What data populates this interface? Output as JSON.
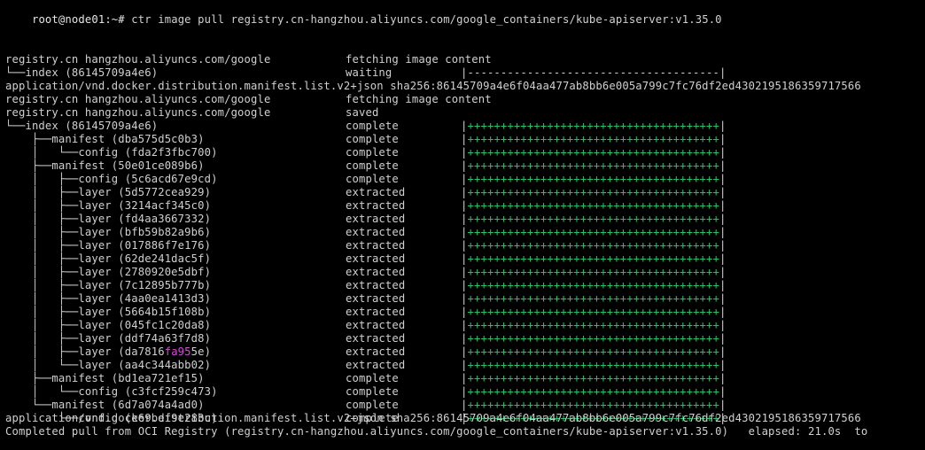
{
  "terminal": {
    "prompt": "root@node01:~#",
    "command": "ctr image pull registry.cn-hangzhou.aliyuncs.com/google_containers/kube-apiserver:v1.35.0",
    "first_block": [
      {
        "name": "registry.cn hangzhou.aliyuncs.com/google",
        "status": "fetching image content"
      },
      {
        "name": "└──index (86145709a4e6)",
        "status": "waiting",
        "bar": "|--------------------------------------|"
      }
    ],
    "manifest_line": "application/vnd.docker.distribution.manifest.list.v2+json sha256:86145709a4e6f04aa477ab8bb6e005a799c7fc76df2ed4302195186359717566",
    "second_block": [
      {
        "name": "registry.cn hangzhou.aliyuncs.com/google",
        "status": "fetching image content"
      },
      {
        "name": "registry.cn hangzhou.aliyuncs.com/google",
        "status": "saved"
      },
      {
        "name": "└──index (86145709a4e6)",
        "status": "complete"
      },
      {
        "name": "    ├──manifest (dba575d5c0b3)",
        "status": "complete"
      },
      {
        "name": "    │   └──config (fda2f3fbc700)",
        "status": "complete"
      },
      {
        "name": "    ├──manifest (50e01ce089b6)",
        "status": "complete"
      },
      {
        "name": "    │   ├──config (5c6acd67e9cd)",
        "status": "complete"
      },
      {
        "name": "    │   ├──layer (5d5772cea929)",
        "status": "extracted"
      },
      {
        "name": "    │   ├──layer (3214acf345c0)",
        "status": "extracted"
      },
      {
        "name": "    │   ├──layer (fd4aa3667332)",
        "status": "extracted"
      },
      {
        "name": "    │   ├──layer (bfb59b82a9b6)",
        "status": "extracted"
      },
      {
        "name": "    │   ├──layer (017886f7e176)",
        "status": "extracted"
      },
      {
        "name": "    │   ├──layer (62de241dac5f)",
        "status": "extracted"
      },
      {
        "name": "    │   ├──layer (2780920e5dbf)",
        "status": "extracted"
      },
      {
        "name": "    │   ├──layer (7c12895b777b)",
        "status": "extracted"
      },
      {
        "name": "    │   ├──layer (4aa0ea1413d3)",
        "status": "extracted"
      },
      {
        "name": "    │   ├──layer (5664b15f108b)",
        "status": "extracted"
      },
      {
        "name": "    │   ├──layer (045fc1c20da8)",
        "status": "extracted"
      },
      {
        "name": "    │   ├──layer (ddf74a63f7d8)",
        "status": "extracted"
      },
      {
        "name": "    │   ├──layer (da7816",
        "highlight": "fa95",
        "name_tail": "5e)",
        "status": "extracted"
      },
      {
        "name": "    │   └──layer (aa4c344abb02)",
        "status": "extracted"
      },
      {
        "name": "    ├──manifest (bd1ea721ef15)",
        "status": "complete"
      },
      {
        "name": "    │   └──config (c3fcf259c473)",
        "status": "complete"
      },
      {
        "name": "    └──manifest (6d7a074a4ad0)",
        "status": "complete"
      },
      {
        "name": "        └──config (e69bef9e283c)",
        "status": "complete"
      }
    ],
    "progress_bar": "++++++++++++++++++++++++++++++++++++++",
    "bar_edge": "|",
    "completed_line": "Completed pull from OCI Registry (registry.cn-hangzhou.aliyuncs.com/google_containers/kube-apiserver:v1.35.0)   elapsed: 21.0s  to"
  },
  "colors": {
    "background": "#000000",
    "text": "#d0d0d0",
    "progress": "#23c36a",
    "highlight": "#d84adf"
  }
}
